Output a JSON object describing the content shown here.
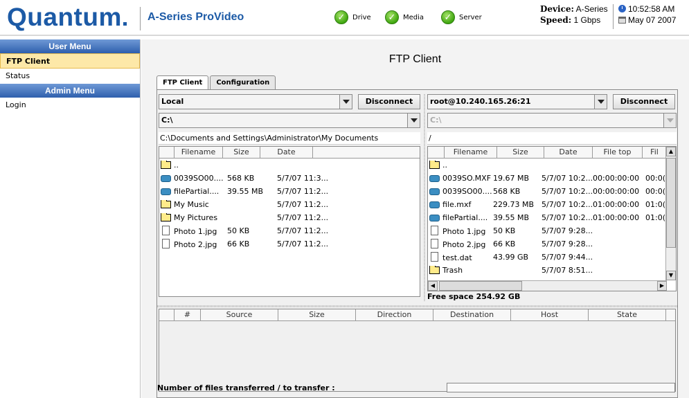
{
  "header": {
    "logo_text": "Quantum",
    "product": "A-Series ProVideo",
    "indicators": [
      {
        "label": "Drive",
        "icon": "check-circle-icon"
      },
      {
        "label": "Media",
        "icon": "check-circle-icon"
      },
      {
        "label": "Server",
        "icon": "check-circle-icon"
      }
    ],
    "device_label": "Device:",
    "device_value": "A-Series",
    "speed_label": "Speed:",
    "speed_value": "1 Gbps",
    "time": "10:52:58 AM",
    "date": "May 07 2007"
  },
  "sidebar": {
    "user_menu_title": "User Menu",
    "user_items": [
      "FTP Client",
      "Status"
    ],
    "admin_menu_title": "Admin Menu",
    "admin_items": [
      "Login"
    ]
  },
  "main": {
    "title": "FTP Client",
    "tabs": [
      "FTP Client",
      "Configuration"
    ]
  },
  "local": {
    "source": "Local",
    "disconnect": "Disconnect",
    "drive": "C:\\",
    "path": "C:\\Documents and Settings\\Administrator\\My Documents",
    "columns": [
      "Filename",
      "Size",
      "Date"
    ],
    "rows": [
      {
        "type": "folder",
        "name": "..",
        "size": "",
        "date": ""
      },
      {
        "type": "video",
        "name": "0039SO00....",
        "size": "568 KB",
        "date": "5/7/07 11:3..."
      },
      {
        "type": "video",
        "name": "filePartial....",
        "size": "39.55 MB",
        "date": "5/7/07 11:2..."
      },
      {
        "type": "folder",
        "name": "My Music",
        "size": "",
        "date": "5/7/07 11:2..."
      },
      {
        "type": "folder",
        "name": "My Pictures",
        "size": "",
        "date": "5/7/07 11:2..."
      },
      {
        "type": "doc",
        "name": "Photo 1.jpg",
        "size": "50 KB",
        "date": "5/7/07 11:2..."
      },
      {
        "type": "doc",
        "name": "Photo 2.jpg",
        "size": "66 KB",
        "date": "5/7/07 11:2..."
      }
    ]
  },
  "remote": {
    "source": "root@10.240.165.26:21",
    "disconnect": "Disconnect",
    "drive": "C:\\",
    "path": "/",
    "columns": [
      "Filename",
      "Size",
      "Date",
      "File top",
      "Fil"
    ],
    "rows": [
      {
        "type": "folder",
        "name": "..",
        "size": "",
        "date": "",
        "top": "",
        "fil": ""
      },
      {
        "type": "video",
        "name": "0039SO.MXF",
        "size": "19.67 MB",
        "date": "5/7/07 10:2...",
        "top": "00:00:00:00",
        "fil": "00:0("
      },
      {
        "type": "video",
        "name": "0039SO00....",
        "size": "568 KB",
        "date": "5/7/07 10:2...",
        "top": "00:00:00:00",
        "fil": "00:0("
      },
      {
        "type": "video",
        "name": "file.mxf",
        "size": "229.73 MB",
        "date": "5/7/07 10:2...",
        "top": "01:00:00:00",
        "fil": "01:0("
      },
      {
        "type": "video",
        "name": "filePartial....",
        "size": "39.55 MB",
        "date": "5/7/07 10:2...",
        "top": "01:00:00:00",
        "fil": "01:0("
      },
      {
        "type": "doc",
        "name": "Photo 1.jpg",
        "size": "50 KB",
        "date": "5/7/07 9:28...",
        "top": "",
        "fil": ""
      },
      {
        "type": "doc",
        "name": "Photo 2.jpg",
        "size": "66 KB",
        "date": "5/7/07 9:28...",
        "top": "",
        "fil": ""
      },
      {
        "type": "doc",
        "name": "test.dat",
        "size": "43.99 GB",
        "date": "5/7/07 9:44...",
        "top": "",
        "fil": ""
      },
      {
        "type": "folder",
        "name": "Trash",
        "size": "",
        "date": "5/7/07 8:51...",
        "top": "",
        "fil": ""
      }
    ],
    "free_space": "Free space 254.92 GB"
  },
  "transfer": {
    "columns": [
      "#",
      "Source",
      "Size",
      "Direction",
      "Destination",
      "Host",
      "State"
    ],
    "footer": "Number of files transferred / to transfer :"
  }
}
